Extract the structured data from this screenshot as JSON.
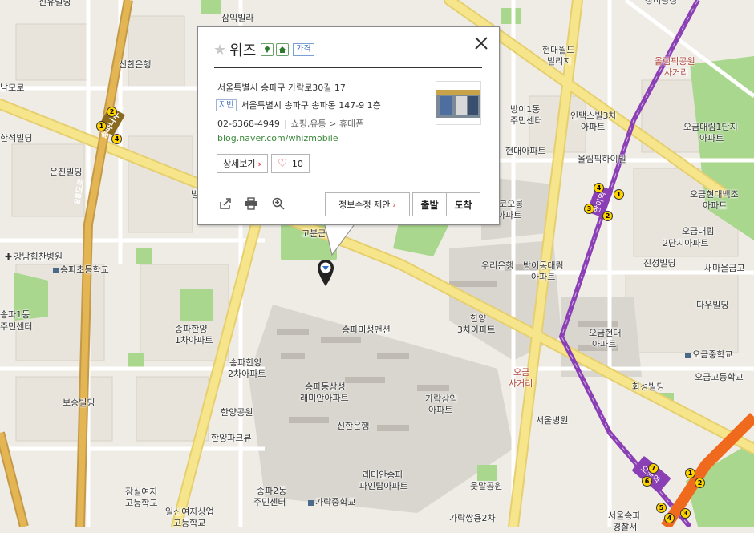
{
  "popup": {
    "name": "위즈",
    "badge_price": "가격",
    "address_road": "서울특별시 송파구 가락로30길 17",
    "jibun_tag": "지번",
    "address_jibun": "서울특별시 송파구 송파동 147-9 1층",
    "phone": "02-6368-4949",
    "category": "쇼핑,유통 > 휴대폰",
    "url": "blog.naver.com/whizmobile",
    "detail_button": "상세보기",
    "like_count": "10",
    "edit_suggest_button": "정보수정 제안",
    "depart_button": "출발",
    "arrive_button": "도착"
  },
  "map_labels": [
    {
      "t": "신유빌딩"
    },
    {
      "t": "삼익빌라"
    },
    {
      "t": "신한은행"
    },
    {
      "t": "남모로"
    },
    {
      "t": "한석빌딩"
    },
    {
      "t": "은진빌딩"
    },
    {
      "t": "빙"
    },
    {
      "t": "강남힘찬병원"
    },
    {
      "t": "송파초등학교"
    },
    {
      "t": "송파1동"
    },
    {
      "t": "주민센터"
    },
    {
      "t": "송파한양"
    },
    {
      "t": "1차아파트"
    },
    {
      "t": "송파한양"
    },
    {
      "t": "2차아파트"
    },
    {
      "t": "보승빌딩"
    },
    {
      "t": "한양공원"
    },
    {
      "t": "한양파크뷰"
    },
    {
      "t": "잠실여자"
    },
    {
      "t": "고등학교"
    },
    {
      "t": "일신여자상업"
    },
    {
      "t": "고등학교"
    },
    {
      "t": "송파2동"
    },
    {
      "t": "주민센터"
    },
    {
      "t": "가락중학교"
    },
    {
      "t": "래미안송파"
    },
    {
      "t": "파인탑아파트"
    },
    {
      "t": "웃말공원"
    },
    {
      "t": "가락쌍용2차"
    },
    {
      "t": "신한은행"
    },
    {
      "t": "송파동삼성"
    },
    {
      "t": "래미안아파트"
    },
    {
      "t": "가락삼익"
    },
    {
      "t": "아파트"
    },
    {
      "t": "송파미성맨션"
    },
    {
      "t": "한양"
    },
    {
      "t": "3차아파트"
    },
    {
      "t": "고분군"
    },
    {
      "t": "우리은행"
    },
    {
      "t": "방이동대림"
    },
    {
      "t": "아파트"
    },
    {
      "t": "코오롱"
    },
    {
      "t": "아파트"
    },
    {
      "t": "현대월드"
    },
    {
      "t": "빌리지"
    },
    {
      "t": "방이1동"
    },
    {
      "t": "주민센터"
    },
    {
      "t": "현대아파트"
    },
    {
      "t": "인택스빌3차"
    },
    {
      "t": "아파트"
    },
    {
      "t": "올림픽하이빌"
    },
    {
      "t": "장미광장"
    },
    {
      "t": "올림픽공원"
    },
    {
      "t": "사거리"
    },
    {
      "t": "오금대림1단지"
    },
    {
      "t": "아파트"
    },
    {
      "t": "오금현대백조"
    },
    {
      "t": "아파트"
    },
    {
      "t": "오금대림"
    },
    {
      "t": "2단지아파트"
    },
    {
      "t": "진성빌딩"
    },
    {
      "t": "새마을금고"
    },
    {
      "t": "다우빌딩"
    },
    {
      "t": "오금현대"
    },
    {
      "t": "아파트"
    },
    {
      "t": "오금중학교"
    },
    {
      "t": "오금고등학교"
    },
    {
      "t": "화성빌딩"
    },
    {
      "t": "오금"
    },
    {
      "t": "사거리"
    },
    {
      "t": "서울병원"
    },
    {
      "t": "서울송파"
    },
    {
      "t": "경찰서"
    },
    {
      "t": "방이역"
    },
    {
      "t": "오금역"
    },
    {
      "t": "송파나루역"
    },
    {
      "t": "88도로"
    }
  ],
  "colors": {
    "accent_red": "#e03c3c",
    "subway_purple": "#8b3fb5",
    "subway_orange": "#f06a1e",
    "road_yellow": "#f6e58a"
  }
}
